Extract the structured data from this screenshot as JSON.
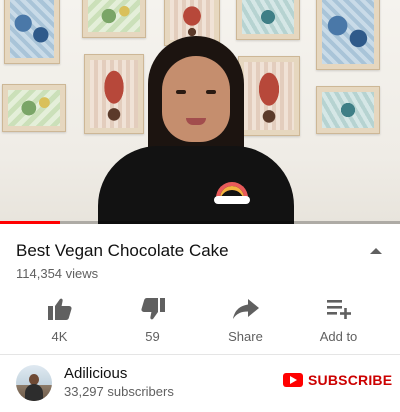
{
  "video": {
    "playback_progress_percent": 15
  },
  "details": {
    "title": "Best Vegan Chocolate Cake",
    "views": "114,354 views"
  },
  "actions": [
    {
      "label": "4K",
      "icon": "thumbs-up-icon"
    },
    {
      "label": "59",
      "icon": "thumbs-down-icon"
    },
    {
      "label": "Share",
      "icon": "share-icon"
    },
    {
      "label": "Add to",
      "icon": "playlist-add-icon"
    }
  ],
  "channel": {
    "name": "Adilicious",
    "subscribers": "33,297 subscribers",
    "subscribe_label": "SUBSCRIBE"
  },
  "colors": {
    "brand_red": "#ff0000",
    "subscribe_text": "#cc0000",
    "secondary_text": "#606060",
    "icon_gray": "#606060"
  }
}
